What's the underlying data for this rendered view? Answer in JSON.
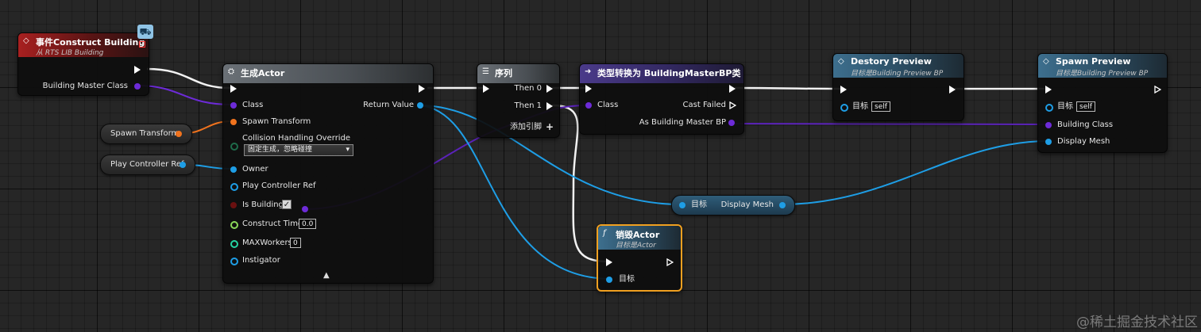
{
  "colors": {
    "exec": "#ffffff",
    "class": "#6d2bd8",
    "struct": "#f0731e",
    "object": "#1e9ee6",
    "float": "#8bd95a",
    "int": "#25d4a4",
    "bool": "#6a1010",
    "selected": "#f0a020"
  },
  "event": {
    "title": "事件Construct Building",
    "subtitle": "从 RTS LIB Building",
    "pin_class": "Building Master Class"
  },
  "spawn_transform_var": {
    "label": "Spawn Transform"
  },
  "play_controller_var": {
    "label": "Play Controller Ref"
  },
  "spawn_actor": {
    "title": "生成Actor",
    "pins": {
      "class": "Class",
      "return_value": "Return Value",
      "spawn_transform": "Spawn Transform",
      "collision": "Collision Handling Override",
      "collision_value": "固定生成，忽略碰撞",
      "owner": "Owner",
      "play_controller_ref": "Play Controller Ref",
      "is_building": "Is Building",
      "construct_time": "Construct Time",
      "construct_time_value": "0.0",
      "max_workers": "MAXWorkers",
      "max_workers_value": "0",
      "instigator": "Instigator"
    }
  },
  "sequence": {
    "title": "序列",
    "then0": "Then 0",
    "then1": "Then 1",
    "add_pin": "添加引脚"
  },
  "cast": {
    "title": "类型转换为 BuildingMasterBP类",
    "class": "Class",
    "cast_failed": "Cast Failed",
    "as_output": "As Building Master BP"
  },
  "destroy_preview": {
    "title": "Destory Preview",
    "subtitle": "目标是Building Preview BP",
    "target": "目标",
    "self": "self"
  },
  "spawn_preview": {
    "title": "Spawn Preview",
    "subtitle": "目标是Building Preview BP",
    "target": "目标",
    "self": "self",
    "building_class": "Building Class",
    "display_mesh": "Display Mesh"
  },
  "get_display_mesh": {
    "target": "目标",
    "output": "Display Mesh"
  },
  "destroy_actor": {
    "title": "销毁Actor",
    "subtitle": "目标是Actor",
    "target": "目标"
  },
  "watermark": "@稀土掘金技术社区"
}
